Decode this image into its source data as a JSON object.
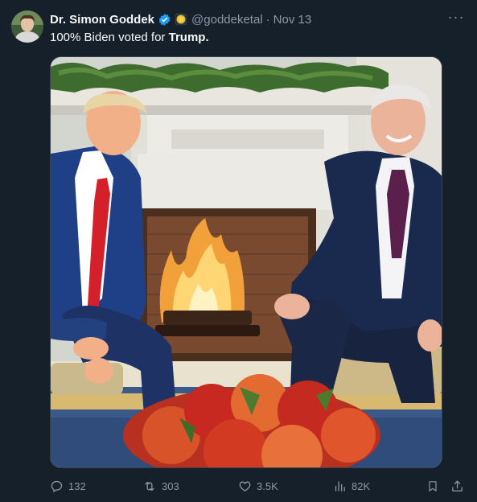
{
  "tweet": {
    "author_name": "Dr. Simon Goddek",
    "handle": "@goddeketal",
    "separator": "·",
    "date": "Nov 13",
    "text_prefix": "100% Biden voted for ",
    "text_bold": "Trump.",
    "more_label": "···"
  },
  "icons": {
    "verified": "verified-badge-icon",
    "affiliate": "affiliate-coin-icon",
    "reply": "reply-icon",
    "retweet": "retweet-icon",
    "like": "heart-icon",
    "views": "analytics-icon",
    "bookmark": "bookmark-icon",
    "share": "share-icon"
  },
  "metrics": {
    "replies": "132",
    "retweets": "303",
    "likes": "3.5K",
    "views": "82K"
  },
  "colors": {
    "background": "#15202b",
    "muted": "#8b98a5",
    "verified_blue": "#1d9bf0",
    "affiliate_gold": "#e8b923"
  }
}
